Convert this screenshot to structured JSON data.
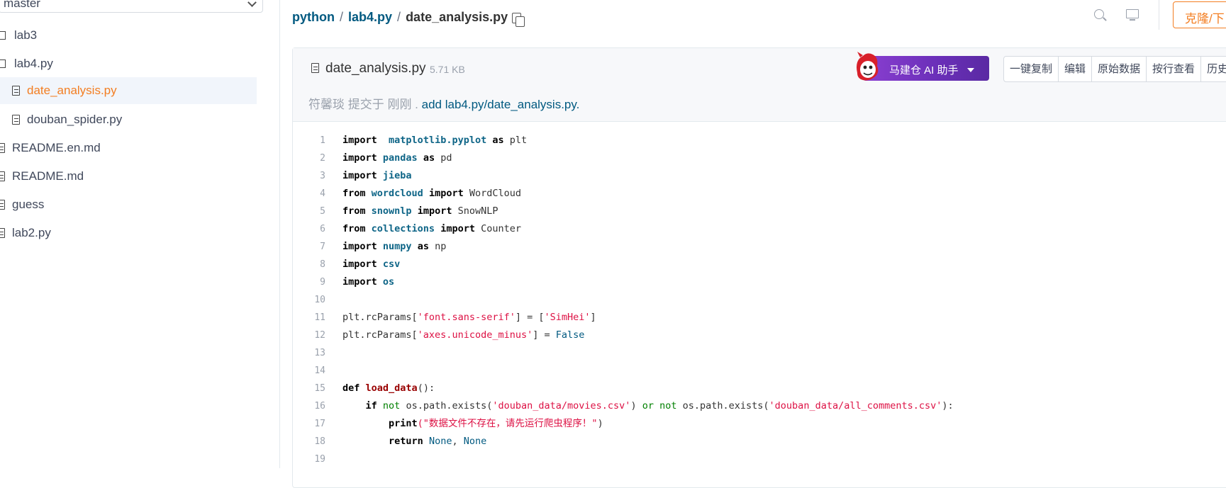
{
  "sidebar": {
    "branch": "master",
    "items": [
      {
        "label": "lab3",
        "type": "folder"
      },
      {
        "label": "lab4.py",
        "type": "folder"
      },
      {
        "label": "date_analysis.py",
        "type": "file",
        "active": true
      },
      {
        "label": "douban_spider.py",
        "type": "file"
      },
      {
        "label": "README.en.md",
        "type": "file"
      },
      {
        "label": "README.md",
        "type": "file"
      },
      {
        "label": "guess",
        "type": "file"
      },
      {
        "label": "lab2.py",
        "type": "file"
      }
    ]
  },
  "breadcrumb": {
    "repo": "python",
    "folder": "lab4.py",
    "file": "date_analysis.py"
  },
  "header": {
    "clone_label": "克隆/下"
  },
  "file": {
    "name": "date_analysis.py",
    "size": "5.71 KB",
    "ai_label": "马建仓 AI 助手",
    "actions": [
      "一键复制",
      "编辑",
      "原始数据",
      "按行查看",
      "历史"
    ],
    "commit_prefix": "符馨琰 提交于 刚刚 . ",
    "commit_message": "add lab4.py/date_analysis.py."
  },
  "code_lines": [
    [
      [
        "kw",
        "import"
      ],
      [
        "",
        "  "
      ],
      [
        "mod",
        "matplotlib.pyplot"
      ],
      [
        "",
        ""
      ],
      [
        "kw",
        " as"
      ],
      [
        "",
        " plt"
      ]
    ],
    [
      [
        "kw",
        "import"
      ],
      [
        "",
        " "
      ],
      [
        "mod",
        "pandas"
      ],
      [
        "kw",
        " as"
      ],
      [
        "",
        " pd"
      ]
    ],
    [
      [
        "kw",
        "import"
      ],
      [
        "",
        " "
      ],
      [
        "mod",
        "jieba"
      ]
    ],
    [
      [
        "kw",
        "from"
      ],
      [
        "",
        " "
      ],
      [
        "mod",
        "wordcloud"
      ],
      [
        "kw",
        " import"
      ],
      [
        "",
        " WordCloud"
      ]
    ],
    [
      [
        "kw",
        "from"
      ],
      [
        "",
        " "
      ],
      [
        "mod",
        "snownlp"
      ],
      [
        "kw",
        " import"
      ],
      [
        "",
        " SnowNLP"
      ]
    ],
    [
      [
        "kw",
        "from"
      ],
      [
        "",
        " "
      ],
      [
        "mod",
        "collections"
      ],
      [
        "kw",
        " import"
      ],
      [
        "",
        " Counter"
      ]
    ],
    [
      [
        "kw",
        "import"
      ],
      [
        "",
        " "
      ],
      [
        "mod",
        "numpy"
      ],
      [
        "kw",
        " as"
      ],
      [
        "",
        " np"
      ]
    ],
    [
      [
        "kw",
        "import"
      ],
      [
        "",
        " "
      ],
      [
        "mod",
        "csv"
      ]
    ],
    [
      [
        "kw",
        "import"
      ],
      [
        "",
        " "
      ],
      [
        "mod",
        "os"
      ]
    ],
    [],
    [
      [
        "",
        "plt.rcParams["
      ],
      [
        "str",
        "'font.sans-serif'"
      ],
      [
        "",
        "] = ["
      ],
      [
        "str",
        "'SimHei'"
      ],
      [
        "",
        "]"
      ]
    ],
    [
      [
        "",
        "plt.rcParams["
      ],
      [
        "str",
        "'axes.unicode_minus'"
      ],
      [
        "",
        "] = "
      ],
      [
        "kc",
        "False"
      ]
    ],
    [],
    [],
    [
      [
        "kw",
        "def"
      ],
      [
        "",
        " "
      ],
      [
        "fn",
        "load_data"
      ],
      [
        "",
        "():"
      ]
    ],
    [
      [
        "",
        "    "
      ],
      [
        "kw",
        "if"
      ],
      [
        "",
        " "
      ],
      [
        "kg",
        "not"
      ],
      [
        "",
        " os.path.exists("
      ],
      [
        "str",
        "'douban_data/movies.csv'"
      ],
      [
        "",
        ") "
      ],
      [
        "kg",
        "or"
      ],
      [
        "",
        " "
      ],
      [
        "kg",
        "not"
      ],
      [
        "",
        " os.path.exists("
      ],
      [
        "str",
        "'douban_data/all_comments.csv'"
      ],
      [
        "",
        "):"
      ]
    ],
    [
      [
        "",
        "        "
      ],
      [
        "kw",
        "print"
      ],
      [
        "str",
        "(\"数据文件不存在，请先运行爬虫程序！\""
      ],
      [
        "",
        ")"
      ]
    ],
    [
      [
        "",
        "        "
      ],
      [
        "kw",
        "return"
      ],
      [
        "",
        " "
      ],
      [
        "kc",
        "None"
      ],
      [
        "",
        ", "
      ],
      [
        "kc",
        "None"
      ]
    ],
    []
  ]
}
